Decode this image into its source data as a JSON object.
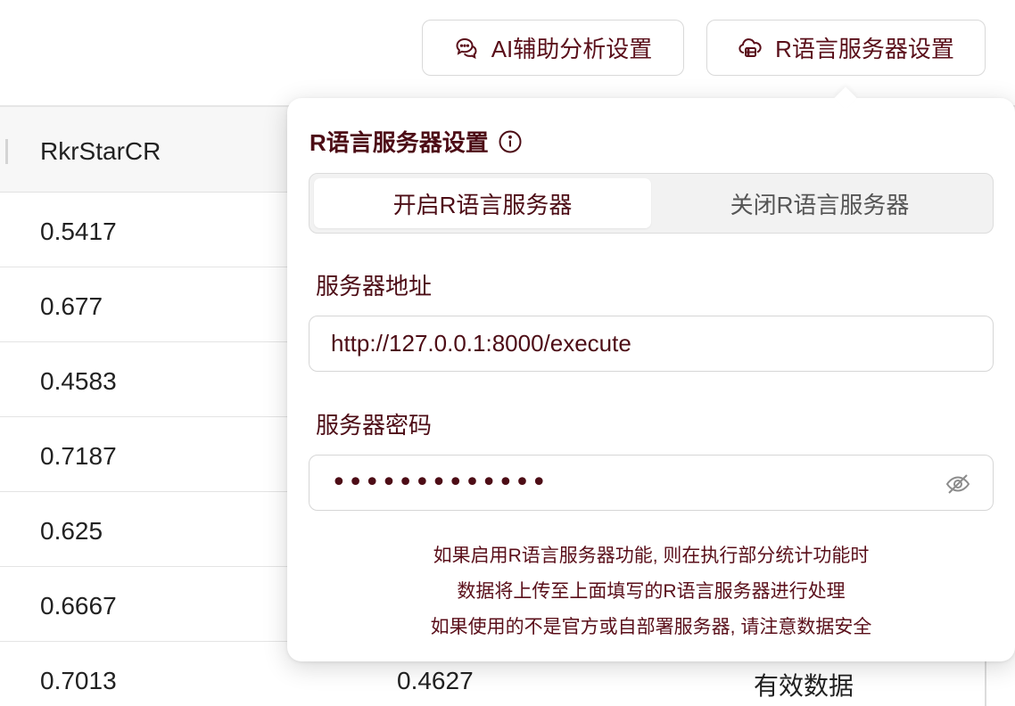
{
  "toolbar": {
    "ai_button_label": "AI辅助分析设置",
    "r_button_label": "R语言服务器设置",
    "ai_icon": "chat-bubbles-icon",
    "r_icon": "cloud-server-icon"
  },
  "table": {
    "header": "RkrStarCR",
    "rows": [
      [
        "0.5417",
        "",
        ""
      ],
      [
        "0.677",
        "",
        ""
      ],
      [
        "0.4583",
        "",
        ""
      ],
      [
        "0.7187",
        "",
        ""
      ],
      [
        "0.625",
        "",
        ""
      ],
      [
        "0.6667",
        "",
        ""
      ],
      [
        "0.7013",
        "0.4627",
        "有效数据"
      ]
    ]
  },
  "popover": {
    "title": "R语言服务器设置",
    "title_icon": "info-icon",
    "segments": [
      "开启R语言服务器",
      "关闭R语言服务器"
    ],
    "active_segment": "开启R语言服务器",
    "address_label": "服务器地址",
    "address_value": "http://127.0.0.1:8000/execute",
    "password_label": "服务器密码",
    "password_masked": "•••••••••••••",
    "password_toggle_icon": "eye-off-icon",
    "notes": [
      "如果启用R语言服务器功能, 则在执行部分统计功能时",
      "数据将上传至上面填写的R语言服务器进行处理",
      "如果使用的不是官方或自部署服务器, 请注意数据安全"
    ]
  },
  "colors": {
    "accent": "#4d0d16",
    "border": "#d6d6d6",
    "segment_bg": "#f2f2f2"
  }
}
